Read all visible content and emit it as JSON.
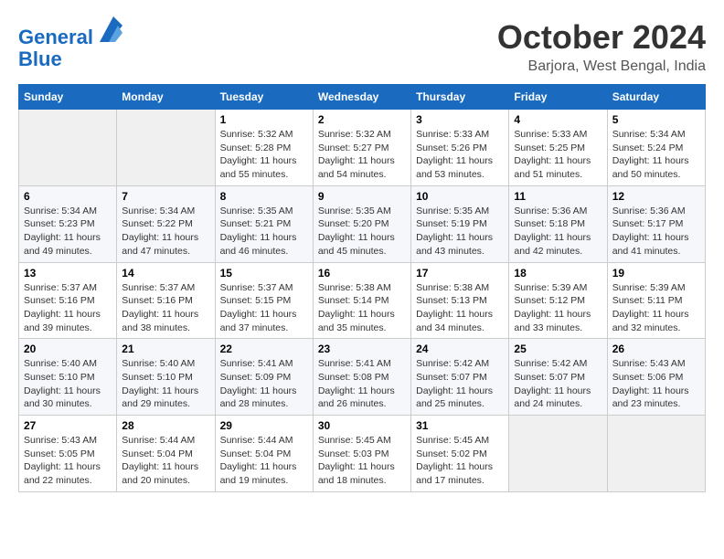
{
  "header": {
    "logo_line1": "General",
    "logo_line2": "Blue",
    "month": "October 2024",
    "location": "Barjora, West Bengal, India"
  },
  "days_of_week": [
    "Sunday",
    "Monday",
    "Tuesday",
    "Wednesday",
    "Thursday",
    "Friday",
    "Saturday"
  ],
  "weeks": [
    [
      {
        "day": "",
        "info": ""
      },
      {
        "day": "",
        "info": ""
      },
      {
        "day": "1",
        "info": "Sunrise: 5:32 AM\nSunset: 5:28 PM\nDaylight: 11 hours and 55 minutes."
      },
      {
        "day": "2",
        "info": "Sunrise: 5:32 AM\nSunset: 5:27 PM\nDaylight: 11 hours and 54 minutes."
      },
      {
        "day": "3",
        "info": "Sunrise: 5:33 AM\nSunset: 5:26 PM\nDaylight: 11 hours and 53 minutes."
      },
      {
        "day": "4",
        "info": "Sunrise: 5:33 AM\nSunset: 5:25 PM\nDaylight: 11 hours and 51 minutes."
      },
      {
        "day": "5",
        "info": "Sunrise: 5:34 AM\nSunset: 5:24 PM\nDaylight: 11 hours and 50 minutes."
      }
    ],
    [
      {
        "day": "6",
        "info": "Sunrise: 5:34 AM\nSunset: 5:23 PM\nDaylight: 11 hours and 49 minutes."
      },
      {
        "day": "7",
        "info": "Sunrise: 5:34 AM\nSunset: 5:22 PM\nDaylight: 11 hours and 47 minutes."
      },
      {
        "day": "8",
        "info": "Sunrise: 5:35 AM\nSunset: 5:21 PM\nDaylight: 11 hours and 46 minutes."
      },
      {
        "day": "9",
        "info": "Sunrise: 5:35 AM\nSunset: 5:20 PM\nDaylight: 11 hours and 45 minutes."
      },
      {
        "day": "10",
        "info": "Sunrise: 5:35 AM\nSunset: 5:19 PM\nDaylight: 11 hours and 43 minutes."
      },
      {
        "day": "11",
        "info": "Sunrise: 5:36 AM\nSunset: 5:18 PM\nDaylight: 11 hours and 42 minutes."
      },
      {
        "day": "12",
        "info": "Sunrise: 5:36 AM\nSunset: 5:17 PM\nDaylight: 11 hours and 41 minutes."
      }
    ],
    [
      {
        "day": "13",
        "info": "Sunrise: 5:37 AM\nSunset: 5:16 PM\nDaylight: 11 hours and 39 minutes."
      },
      {
        "day": "14",
        "info": "Sunrise: 5:37 AM\nSunset: 5:16 PM\nDaylight: 11 hours and 38 minutes."
      },
      {
        "day": "15",
        "info": "Sunrise: 5:37 AM\nSunset: 5:15 PM\nDaylight: 11 hours and 37 minutes."
      },
      {
        "day": "16",
        "info": "Sunrise: 5:38 AM\nSunset: 5:14 PM\nDaylight: 11 hours and 35 minutes."
      },
      {
        "day": "17",
        "info": "Sunrise: 5:38 AM\nSunset: 5:13 PM\nDaylight: 11 hours and 34 minutes."
      },
      {
        "day": "18",
        "info": "Sunrise: 5:39 AM\nSunset: 5:12 PM\nDaylight: 11 hours and 33 minutes."
      },
      {
        "day": "19",
        "info": "Sunrise: 5:39 AM\nSunset: 5:11 PM\nDaylight: 11 hours and 32 minutes."
      }
    ],
    [
      {
        "day": "20",
        "info": "Sunrise: 5:40 AM\nSunset: 5:10 PM\nDaylight: 11 hours and 30 minutes."
      },
      {
        "day": "21",
        "info": "Sunrise: 5:40 AM\nSunset: 5:10 PM\nDaylight: 11 hours and 29 minutes."
      },
      {
        "day": "22",
        "info": "Sunrise: 5:41 AM\nSunset: 5:09 PM\nDaylight: 11 hours and 28 minutes."
      },
      {
        "day": "23",
        "info": "Sunrise: 5:41 AM\nSunset: 5:08 PM\nDaylight: 11 hours and 26 minutes."
      },
      {
        "day": "24",
        "info": "Sunrise: 5:42 AM\nSunset: 5:07 PM\nDaylight: 11 hours and 25 minutes."
      },
      {
        "day": "25",
        "info": "Sunrise: 5:42 AM\nSunset: 5:07 PM\nDaylight: 11 hours and 24 minutes."
      },
      {
        "day": "26",
        "info": "Sunrise: 5:43 AM\nSunset: 5:06 PM\nDaylight: 11 hours and 23 minutes."
      }
    ],
    [
      {
        "day": "27",
        "info": "Sunrise: 5:43 AM\nSunset: 5:05 PM\nDaylight: 11 hours and 22 minutes."
      },
      {
        "day": "28",
        "info": "Sunrise: 5:44 AM\nSunset: 5:04 PM\nDaylight: 11 hours and 20 minutes."
      },
      {
        "day": "29",
        "info": "Sunrise: 5:44 AM\nSunset: 5:04 PM\nDaylight: 11 hours and 19 minutes."
      },
      {
        "day": "30",
        "info": "Sunrise: 5:45 AM\nSunset: 5:03 PM\nDaylight: 11 hours and 18 minutes."
      },
      {
        "day": "31",
        "info": "Sunrise: 5:45 AM\nSunset: 5:02 PM\nDaylight: 11 hours and 17 minutes."
      },
      {
        "day": "",
        "info": ""
      },
      {
        "day": "",
        "info": ""
      }
    ]
  ]
}
